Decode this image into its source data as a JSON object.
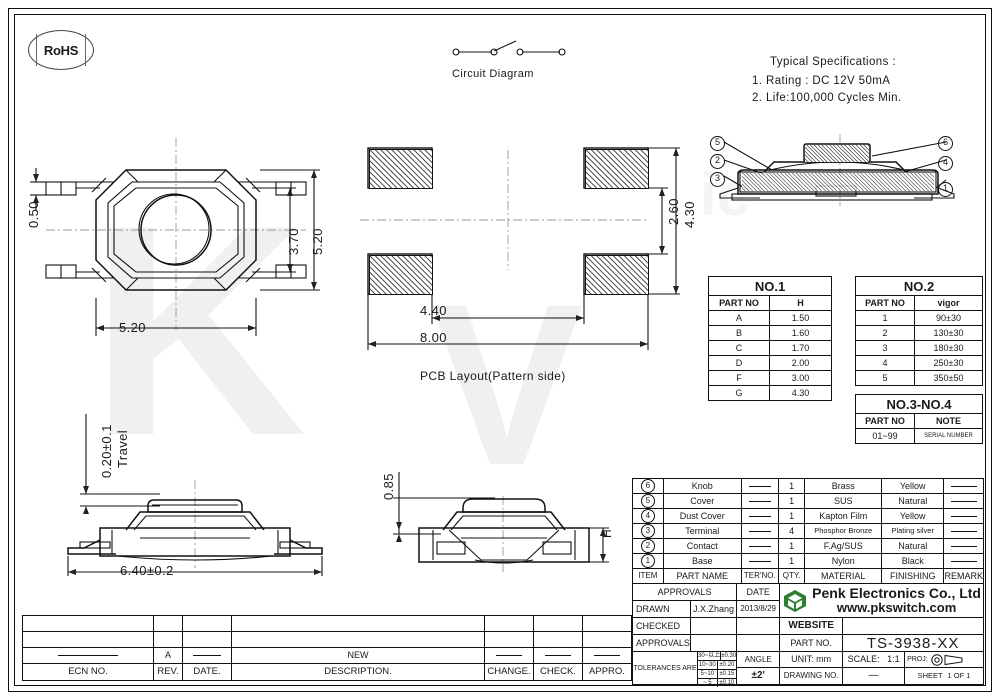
{
  "sheet": {
    "rohs_label": "RoHS",
    "circuit_caption": "Circuit Diagram",
    "pcb_caption": "PCB Layout(Pattern side)"
  },
  "specs": {
    "title": "Typical Specifications :",
    "line1": "1. Rating : DC 12V 50mA",
    "line2": "2. Life:100,000 Cycles Min."
  },
  "top_view_dims": {
    "width": "5.20",
    "height": "5.20",
    "inner_height": "3.70",
    "terminal": "0.50"
  },
  "pcb_dims": {
    "overall_w": "8.00",
    "inner_w": "4.40",
    "inner_h": "2.60",
    "overall_h": "4.30"
  },
  "side_view_dims": {
    "travel": "0.20±0.1",
    "travel_label": "Travel",
    "span": "6.40±0.2"
  },
  "front_view_dims": {
    "knob_height": "0.85",
    "height_symbol": "H"
  },
  "section_balloons": [
    "1",
    "2",
    "3",
    "4",
    "5",
    "6"
  ],
  "table_no1": {
    "title": "NO.1",
    "headers": [
      "PART NO",
      "H"
    ],
    "rows": [
      [
        "A",
        "1.50"
      ],
      [
        "B",
        "1.60"
      ],
      [
        "C",
        "1.70"
      ],
      [
        "D",
        "2.00"
      ],
      [
        "F",
        "3.00"
      ],
      [
        "G",
        "4.30"
      ]
    ]
  },
  "table_no2": {
    "title": "NO.2",
    "headers": [
      "PART NO",
      "vigor"
    ],
    "rows": [
      [
        "1",
        "90±30"
      ],
      [
        "2",
        "130±30"
      ],
      [
        "3",
        "180±30"
      ],
      [
        "4",
        "250±30"
      ],
      [
        "5",
        "350±50"
      ]
    ]
  },
  "table_no34": {
    "title": "NO.3-NO.4",
    "headers": [
      "PART NO",
      "NOTE"
    ],
    "rows": [
      [
        "01~99",
        "SERIAL NUMBER"
      ]
    ]
  },
  "bom": {
    "headers": [
      "ITEM",
      "PART NAME",
      "TER'NO.",
      "QTY.",
      "MATERIAL",
      "FINISHING",
      "REMARK"
    ],
    "rows": [
      {
        "item": "6",
        "part_name": "Knob",
        "ter_no": "—",
        "qty": "1",
        "material": "Brass",
        "finishing": "Yellow",
        "remark": "—"
      },
      {
        "item": "5",
        "part_name": "Cover",
        "ter_no": "—",
        "qty": "1",
        "material": "SUS",
        "finishing": "Natural",
        "remark": "—"
      },
      {
        "item": "4",
        "part_name": "Dust Cover",
        "ter_no": "—",
        "qty": "1",
        "material": "Kapton Film",
        "finishing": "Yellow",
        "remark": "—"
      },
      {
        "item": "3",
        "part_name": "Terminal",
        "ter_no": "—",
        "qty": "4",
        "material": "Phosphor Bronze",
        "finishing": "Plating silver",
        "remark": "—"
      },
      {
        "item": "2",
        "part_name": "Contact",
        "ter_no": "—",
        "qty": "1",
        "material": "F.Ag/SUS",
        "finishing": "Natural",
        "remark": "—"
      },
      {
        "item": "1",
        "part_name": "Base",
        "ter_no": "—",
        "qty": "1",
        "material": "Nylon",
        "finishing": "Black",
        "remark": "—"
      }
    ]
  },
  "titleblock": {
    "approvals_label": "APPROVALS",
    "date_label": "DATE",
    "drawn_label": "DRAWN",
    "drawn_by": "J.X.Zhang",
    "drawn_date": "2013/8/29",
    "checked_label": "CHECKED",
    "checked_by": "",
    "checked_date": "",
    "approvals2_label": "APPROVALS",
    "approvals2_by": "",
    "approvals2_date": "",
    "company": "Penk Electronics Co., Ltd",
    "website_url": "www.pkswitch.com",
    "website_label": "WEBSITE",
    "website_value": "",
    "partno_label": "PART NO.",
    "partno_value": "TS-3938-XX",
    "tolerances_label": "TOLERANCES ARE",
    "tolerances": [
      [
        "30~以上",
        "±0.30"
      ],
      [
        "10~30",
        "±0.20"
      ],
      [
        "5~10",
        "±0.15"
      ],
      [
        "~ 5",
        "±0.10"
      ]
    ],
    "angle_label": "ANGLE",
    "angle_value": "±2'",
    "unit_label": "UNIT:",
    "unit_value": "mm",
    "scale_label": "SCALE:",
    "scale_value": "1:1",
    "proj_label": "PROJ:",
    "drawingno_label": "DRAWING NO.",
    "drawingno_value": "—",
    "sheet_label": "SHEET",
    "sheet_value": "1 OF 1"
  },
  "revision": {
    "headers": [
      "ECN NO.",
      "REV.",
      "DATE.",
      "DESCRIPTION.",
      "CHANGE.",
      "CHECK.",
      "APPRO."
    ],
    "rows": [
      {
        "ecn": "",
        "rev": "",
        "date": "",
        "desc": "",
        "change": "",
        "check": "",
        "appro": ""
      },
      {
        "ecn": "",
        "rev": "",
        "date": "",
        "desc": "",
        "change": "",
        "check": "",
        "appro": ""
      },
      {
        "ecn": "—",
        "rev": "A",
        "date": "—",
        "desc": "NEW",
        "change": "—",
        "check": "—",
        "appro": "—"
      }
    ]
  },
  "watermark": "K"
}
